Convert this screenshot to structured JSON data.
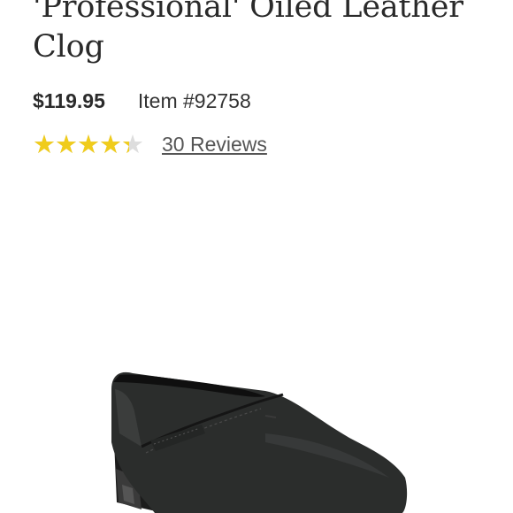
{
  "product": {
    "title_line1": "'Professional' Oiled Leather",
    "title_line2": "Clog",
    "price": "$119.95",
    "item_number": "Item #92758",
    "rating": 4.5,
    "rating_max": 5,
    "rating_stars": "★★★★★",
    "reviews_label": "30 Reviews",
    "image_icon": "clog-shoe-image"
  },
  "colors": {
    "star_filled": "#f0cc1c",
    "star_empty": "#dddddd",
    "text_dark": "#2a2a2a",
    "link": "#555555"
  }
}
